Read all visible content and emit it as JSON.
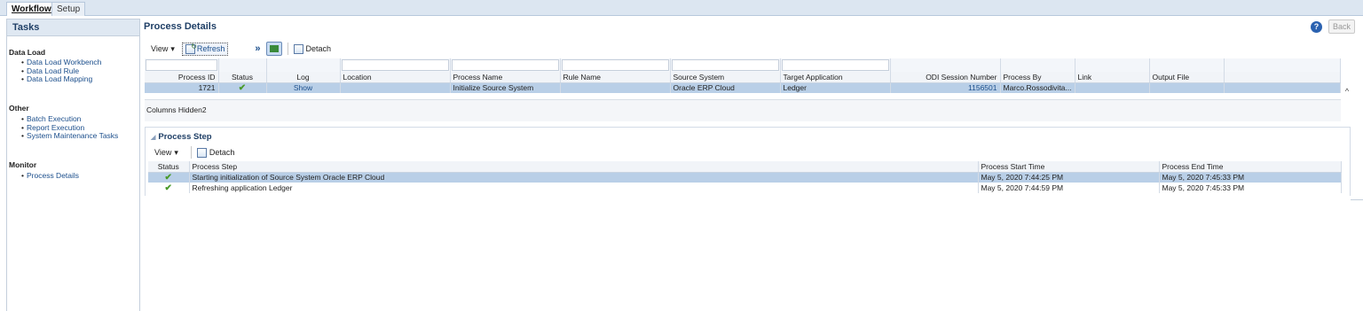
{
  "tabs": [
    {
      "label": "Workflow",
      "active": true
    },
    {
      "label": "Setup",
      "active": false
    }
  ],
  "tasks": {
    "title": "Tasks",
    "sections": [
      {
        "title": "Data Load",
        "items": [
          "Data Load Workbench",
          "Data Load Rule",
          "Data Load Mapping"
        ]
      },
      {
        "title": "Other",
        "items": [
          "Batch Execution",
          "Report Execution",
          "System Maintenance Tasks"
        ]
      },
      {
        "title": "Monitor",
        "items": [
          "Process Details"
        ]
      }
    ]
  },
  "header": {
    "title": "Process Details",
    "help": "?",
    "back_label": "Back"
  },
  "toolbar": {
    "view_label": "View",
    "refresh_label": "Refresh",
    "more": "»",
    "detach_label": "Detach"
  },
  "process_table": {
    "columns": [
      "Process ID",
      "Status",
      "Log",
      "Location",
      "Process Name",
      "Rule Name",
      "Source System",
      "Target Application",
      "ODI Session Number",
      "Process By",
      "Link",
      "Output File"
    ],
    "rows": [
      {
        "process_id": "1721",
        "status": "success",
        "log": "Show",
        "location": "",
        "process_name": "Initialize Source System",
        "rule_name": "",
        "source_system": "Oracle ERP Cloud",
        "target_application": "Ledger",
        "odi_session_number": "1156501",
        "process_by": "Marco.Rossodivita...",
        "link": "",
        "output_file": ""
      }
    ],
    "columns_hidden_label": "Columns Hidden",
    "columns_hidden_count": "2"
  },
  "process_step": {
    "title": "Process Step",
    "toolbar": {
      "view_label": "View",
      "detach_label": "Detach"
    },
    "columns": [
      "Status",
      "Process Step",
      "Process Start Time",
      "Process End Time"
    ],
    "rows": [
      {
        "status": "success",
        "step": "Starting initialization of Source System Oracle ERP Cloud",
        "start": "May 5, 2020 7:44:25 PM",
        "end": "May 5, 2020 7:45:33 PM"
      },
      {
        "status": "success",
        "step": "Refreshing application Ledger",
        "start": "May 5, 2020 7:44:59 PM",
        "end": "May 5, 2020 7:45:33 PM"
      }
    ]
  },
  "colors": {
    "accent": "#1f3f66",
    "link": "#1c4f8c",
    "selected_row": "#b9cfe7",
    "success": "#4a9a2a"
  }
}
